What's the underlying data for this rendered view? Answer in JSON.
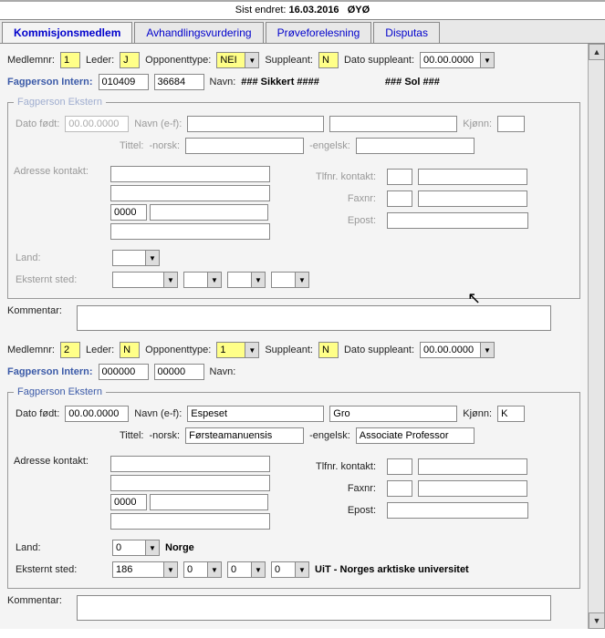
{
  "header": {
    "sist_endret_lbl": "Sist endret:",
    "sist_endret_date": "16.03.2016",
    "sist_endret_user": "ØYØ"
  },
  "tabs": {
    "t0": "Kommisjonsmedlem",
    "t1": "Avhandlingsvurdering",
    "t2": "Prøveforelesning",
    "t3": "Disputas"
  },
  "m1": {
    "medlemnr_lbl": "Medlemnr:",
    "medlemnr": "1",
    "leder_lbl": "Leder:",
    "leder": "J",
    "opptype_lbl": "Opponenttype:",
    "opptype": "NEI",
    "suppleant_lbl": "Suppleant:",
    "suppleant": "N",
    "dato_supp_lbl": "Dato suppleant:",
    "dato_supp": "00.00.0000",
    "fagp_int_lbl": "Fagperson Intern:",
    "fagp_int_a": "010409",
    "fagp_int_b": "36684",
    "navn_lbl": "Navn:",
    "navn1": "### Sikkert ####",
    "navn2": "### Sol ###",
    "legend": "Fagperson Ekstern",
    "dato_fodt_lbl": "Dato født:",
    "dato_fodt": "00.00.0000",
    "navn_ef_lbl": "Navn (e-f):",
    "kjonn_lbl": "Kjønn:",
    "tittel_lbl": "Tittel:",
    "tittel_norsk": "-norsk:",
    "tittel_eng": "-engelsk:",
    "adresse_lbl": "Adresse kontakt:",
    "tlf_lbl": "Tlfnr. kontakt:",
    "fax_lbl": "Faxnr:",
    "epost_lbl": "Epost:",
    "post": "0000",
    "land_lbl": "Land:",
    "eksternt_lbl": "Eksternt sted:",
    "kommentar_lbl": "Kommentar:"
  },
  "m2": {
    "medlemnr_lbl": "Medlemnr:",
    "medlemnr": "2",
    "leder_lbl": "Leder:",
    "leder": "N",
    "opptype_lbl": "Opponenttype:",
    "opptype": "1",
    "suppleant_lbl": "Suppleant:",
    "suppleant": "N",
    "dato_supp_lbl": "Dato suppleant:",
    "dato_supp": "00.00.0000",
    "fagp_int_lbl": "Fagperson Intern:",
    "fagp_int_a": "000000",
    "fagp_int_b": "00000",
    "navn_lbl": "Navn:",
    "legend": "Fagperson Ekstern",
    "dato_fodt_lbl": "Dato født:",
    "dato_fodt": "00.00.0000",
    "navn_ef_lbl": "Navn (e-f):",
    "navn_e": "Espeset",
    "navn_f": "Gro",
    "kjonn_lbl": "Kjønn:",
    "kjonn": "K",
    "tittel_lbl": "Tittel:",
    "tittel_norsk": "-norsk:",
    "tittel_norsk_v": "Førsteamanuensis",
    "tittel_eng": "-engelsk:",
    "tittel_eng_v": "Associate Professor",
    "adresse_lbl": "Adresse kontakt:",
    "tlf_lbl": "Tlfnr. kontakt:",
    "fax_lbl": "Faxnr:",
    "epost_lbl": "Epost:",
    "post": "0000",
    "land_lbl": "Land:",
    "land_v": "0",
    "land_txt": "Norge",
    "eksternt_lbl": "Eksternt sted:",
    "ext_a": "186",
    "ext_b": "0",
    "ext_c": "0",
    "ext_d": "0",
    "ext_txt": "UiT - Norges arktiske universitet",
    "kommentar_lbl": "Kommentar:"
  }
}
